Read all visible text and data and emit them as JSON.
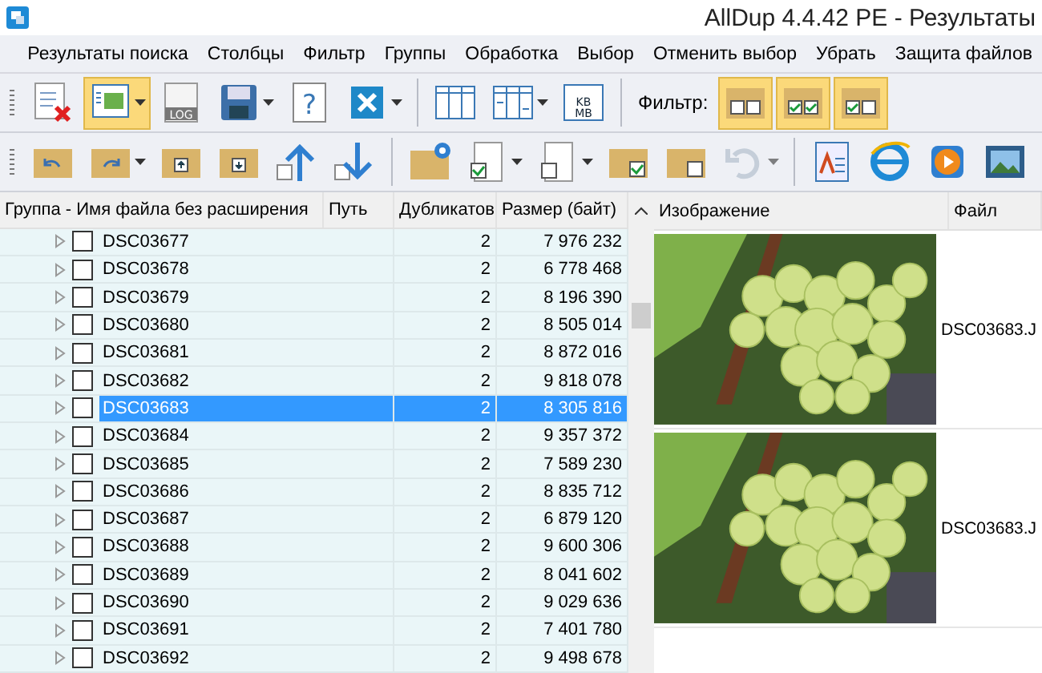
{
  "window": {
    "title": "AllDup 4.4.42 PE - Результаты"
  },
  "menu": [
    "Результаты поиска",
    "Столбцы",
    "Фильтр",
    "Группы",
    "Обработка",
    "Выбор",
    "Отменить выбор",
    "Убрать",
    "Защита файлов"
  ],
  "toolbar_1": [
    {
      "kind": "list-remove",
      "on": false,
      "dropdown": false
    },
    {
      "kind": "image-view",
      "on": true,
      "dropdown": true
    },
    {
      "kind": "log",
      "on": false,
      "dropdown": false,
      "label": "LOG"
    },
    {
      "kind": "save",
      "on": false,
      "dropdown": true
    },
    {
      "kind": "help",
      "on": false,
      "dropdown": false,
      "label": "?"
    },
    {
      "kind": "close",
      "on": false,
      "dropdown": true
    },
    {
      "kind": "separator"
    },
    {
      "kind": "columns",
      "on": false,
      "dropdown": false
    },
    {
      "kind": "columns-resize",
      "on": false,
      "dropdown": true
    },
    {
      "kind": "units",
      "on": false,
      "dropdown": false,
      "label": "KB MB"
    },
    {
      "kind": "separator"
    },
    {
      "kind": "text",
      "label": "Фильтр:"
    },
    {
      "kind": "filter-empty",
      "on": true,
      "dropdown": false
    },
    {
      "kind": "filter-checked",
      "on": true,
      "dropdown": false
    },
    {
      "kind": "filter-partial",
      "on": true,
      "dropdown": false
    }
  ],
  "toolbar_2": [
    {
      "kind": "folder-back",
      "on": false,
      "dropdown": false
    },
    {
      "kind": "folder-forward",
      "on": false,
      "dropdown": true
    },
    {
      "kind": "folder-up",
      "on": false,
      "dropdown": false
    },
    {
      "kind": "folder-down",
      "on": false,
      "dropdown": false
    },
    {
      "kind": "arrow-up",
      "on": false,
      "dropdown": false
    },
    {
      "kind": "arrow-down",
      "on": false,
      "dropdown": false
    },
    {
      "kind": "separator"
    },
    {
      "kind": "folder-gear",
      "on": false,
      "dropdown": false
    },
    {
      "kind": "doc-checked",
      "on": false,
      "dropdown": true
    },
    {
      "kind": "doc-unchecked",
      "on": false,
      "dropdown": true
    },
    {
      "kind": "folder-checked",
      "on": false,
      "dropdown": false
    },
    {
      "kind": "folder-unchecked",
      "on": false,
      "dropdown": false
    },
    {
      "kind": "undo",
      "on": false,
      "dropdown": true,
      "disabled": true
    },
    {
      "kind": "separator"
    },
    {
      "kind": "font-doc",
      "on": false,
      "dropdown": false
    },
    {
      "kind": "browser",
      "on": false,
      "dropdown": false
    },
    {
      "kind": "play",
      "on": false,
      "dropdown": false
    },
    {
      "kind": "picture",
      "on": false,
      "dropdown": false
    }
  ],
  "table": {
    "columns": [
      "Группа - Имя файла без расширения",
      "Путь",
      "Дубликатов",
      "Размер (байт)"
    ],
    "rows": [
      {
        "name": "DSC03677",
        "path": "",
        "duplicates": "2",
        "size": "7 976 232",
        "checked": false,
        "selected": false
      },
      {
        "name": "DSC03678",
        "path": "",
        "duplicates": "2",
        "size": "6 778 468",
        "checked": false,
        "selected": false
      },
      {
        "name": "DSC03679",
        "path": "",
        "duplicates": "2",
        "size": "8 196 390",
        "checked": false,
        "selected": false
      },
      {
        "name": "DSC03680",
        "path": "",
        "duplicates": "2",
        "size": "8 505 014",
        "checked": false,
        "selected": false
      },
      {
        "name": "DSC03681",
        "path": "",
        "duplicates": "2",
        "size": "8 872 016",
        "checked": false,
        "selected": false
      },
      {
        "name": "DSC03682",
        "path": "",
        "duplicates": "2",
        "size": "9 818 078",
        "checked": false,
        "selected": false
      },
      {
        "name": "DSC03683",
        "path": "",
        "duplicates": "2",
        "size": "8 305 816",
        "checked": false,
        "selected": true
      },
      {
        "name": "DSC03684",
        "path": "",
        "duplicates": "2",
        "size": "9 357 372",
        "checked": false,
        "selected": false
      },
      {
        "name": "DSC03685",
        "path": "",
        "duplicates": "2",
        "size": "7 589 230",
        "checked": false,
        "selected": false
      },
      {
        "name": "DSC03686",
        "path": "",
        "duplicates": "2",
        "size": "8 835 712",
        "checked": false,
        "selected": false
      },
      {
        "name": "DSC03687",
        "path": "",
        "duplicates": "2",
        "size": "6 879 120",
        "checked": false,
        "selected": false
      },
      {
        "name": "DSC03688",
        "path": "",
        "duplicates": "2",
        "size": "9 600 306",
        "checked": false,
        "selected": false
      },
      {
        "name": "DSC03689",
        "path": "",
        "duplicates": "2",
        "size": "8 041 602",
        "checked": false,
        "selected": false
      },
      {
        "name": "DSC03690",
        "path": "",
        "duplicates": "2",
        "size": "9 029 636",
        "checked": false,
        "selected": false
      },
      {
        "name": "DSC03691",
        "path": "",
        "duplicates": "2",
        "size": "7 401 780",
        "checked": false,
        "selected": false
      },
      {
        "name": "DSC03692",
        "path": "",
        "duplicates": "2",
        "size": "9 498 678",
        "checked": false,
        "selected": false
      }
    ]
  },
  "preview": {
    "columns": [
      "Изображение",
      "Файл"
    ],
    "rows": [
      {
        "file": "DSC03683.J"
      },
      {
        "file": "DSC03683.J"
      }
    ]
  }
}
